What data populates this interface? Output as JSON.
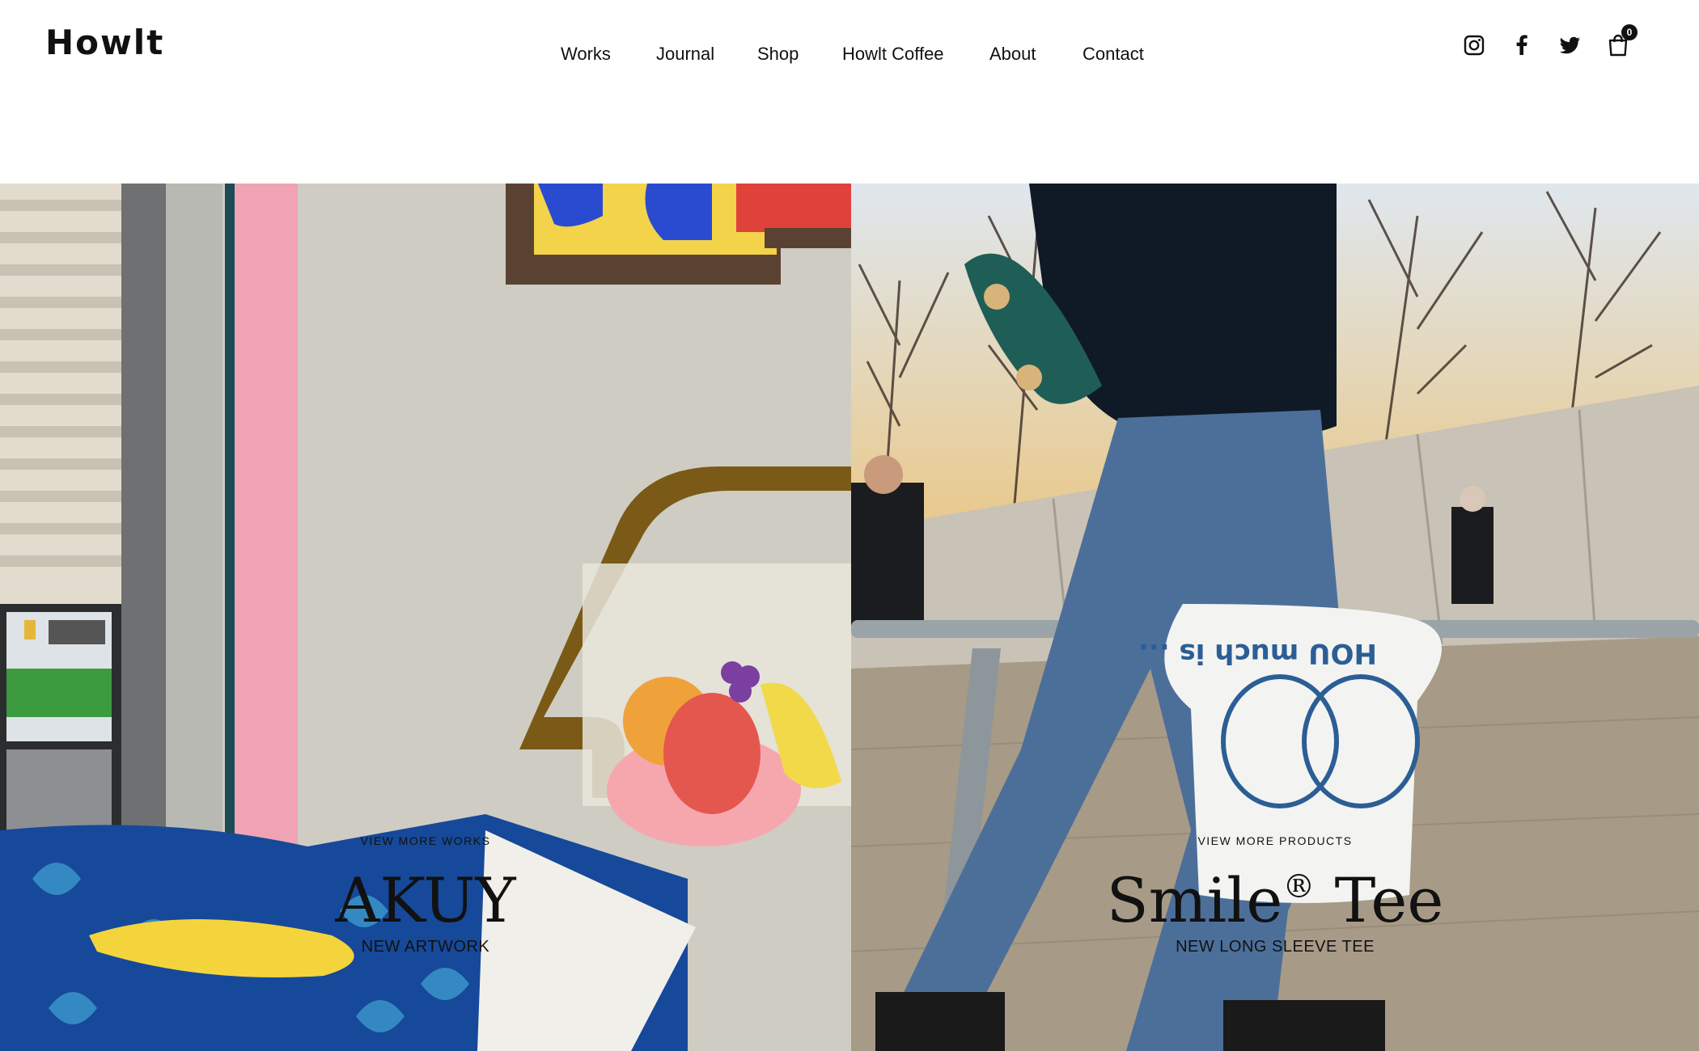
{
  "header": {
    "logo": "Howlt",
    "nav": [
      "Works",
      "Journal",
      "Shop",
      "Howlt Coffee",
      "About",
      "Contact"
    ],
    "social_icons": [
      "instagram-icon",
      "facebook-icon",
      "twitter-icon"
    ],
    "cart": {
      "icon": "shopping-bag-icon",
      "count": "0"
    }
  },
  "hero": {
    "left": {
      "kicker": "VIEW MORE WORKS",
      "title": "AKUY",
      "subtitle": "NEW ARTWORK"
    },
    "right": {
      "kicker": "VIEW MORE PRODUCTS",
      "title": "Smile",
      "title_mark": "®",
      "title_rest": " Tee",
      "subtitle": "NEW LONG SLEEVE TEE"
    }
  }
}
